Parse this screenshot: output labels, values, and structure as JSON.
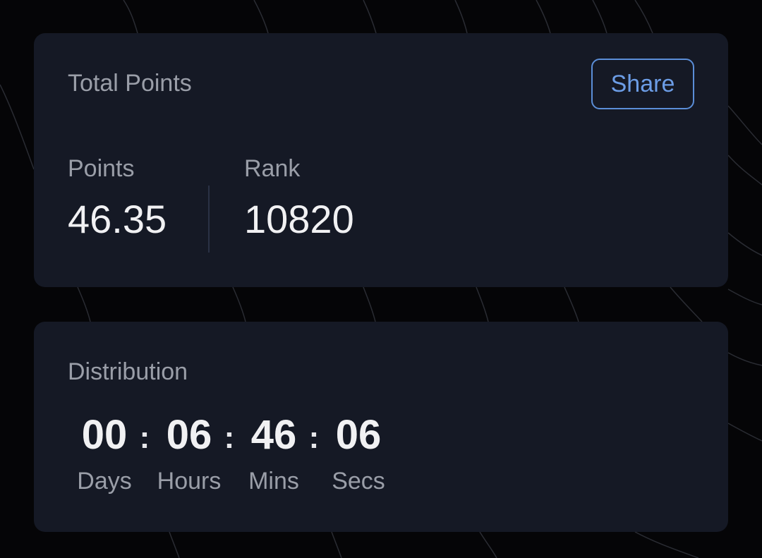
{
  "total_points": {
    "title": "Total Points",
    "share_label": "Share",
    "points_label": "Points",
    "points_value": "46.35",
    "rank_label": "Rank",
    "rank_value": "10820"
  },
  "distribution": {
    "title": "Distribution",
    "separator": ":",
    "units": [
      {
        "value": "00",
        "label": "Days"
      },
      {
        "value": "06",
        "label": "Hours"
      },
      {
        "value": "46",
        "label": "Mins"
      },
      {
        "value": "06",
        "label": "Secs"
      }
    ]
  },
  "colors": {
    "background": "#050507",
    "card": "#151925",
    "accent": "#6c9de6",
    "muted_text": "#9a9ea8",
    "primary_text": "#f1f1f3"
  }
}
